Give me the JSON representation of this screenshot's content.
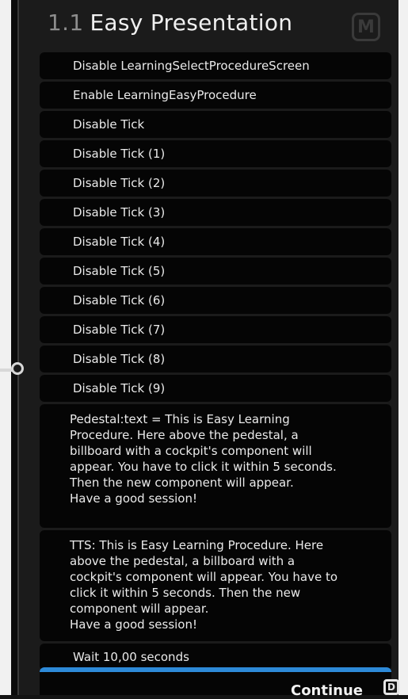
{
  "node": {
    "title_number": "1.1",
    "title_text": "Easy Presentation",
    "badge": "M"
  },
  "actions": [
    "Disable LearningSelectProcedureScreen",
    "Enable LearningEasyProcedure",
    "Disable Tick",
    "Disable Tick (1)",
    "Disable Tick (2)",
    "Disable Tick (3)",
    "Disable Tick (4)",
    "Disable Tick (5)",
    "Disable Tick (6)",
    "Disable Tick (7)",
    "Disable Tick (8)",
    "Disable Tick (9)"
  ],
  "pedestal_text_lines": [
    "Pedestal:text = This is Easy Learning",
    "Procedure. Here above the pedestal, a",
    "billboard with a cockpit's component will",
    "appear. You have to click it within 5 seconds.",
    "Then the new component will appear.",
    "Have a good session!"
  ],
  "tts_text_lines": [
    "TTS: This is Easy Learning Procedure. Here",
    "above the pedestal, a billboard with a",
    "cockpit's component will appear. You have to",
    "click it within 5 seconds. Then the new",
    "component will appear.",
    "Have a good session!"
  ],
  "wait_action": "Wait 10,00 seconds",
  "continue_label": "Continue",
  "continue_port_glyph": "D",
  "colors": {
    "accent_blue": "#2d8ad8",
    "panel": "#1b1b1b",
    "item_bg": "#050505"
  }
}
